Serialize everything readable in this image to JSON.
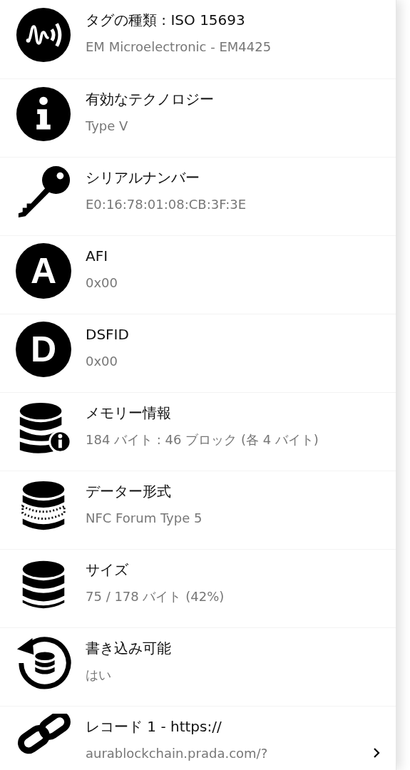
{
  "rows": [
    {
      "kind": "nfc",
      "title": "タグの種類 : ISO 15693",
      "value": "EM Microelectronic - EM4425"
    },
    {
      "kind": "info",
      "title": "有効なテクノロジー",
      "value": "Type V"
    },
    {
      "kind": "key",
      "title": "シリアルナンバー",
      "value": "E0:16:78:01:08:CB:3F:3E"
    },
    {
      "kind": "letter",
      "letter": "A",
      "title": "AFI",
      "value": "0x00"
    },
    {
      "kind": "letter",
      "letter": "D",
      "title": "DSFID",
      "value": "0x00"
    },
    {
      "kind": "dbinfo",
      "title": "メモリー情報",
      "value": "184 バイト : 46 ブロック (各 4 バイト)"
    },
    {
      "kind": "dbformat",
      "title": "データー形式",
      "value": "NFC Forum Type 5"
    },
    {
      "kind": "database",
      "title": "サイズ",
      "value": "75 / 178 バイト (42%)"
    },
    {
      "kind": "dbrefresh",
      "title": "書き込み可能",
      "value": "はい"
    },
    {
      "kind": "link",
      "title": "レコード 1 - https://",
      "value": "aurablockchain.prada.com/?",
      "chevron": true
    }
  ]
}
